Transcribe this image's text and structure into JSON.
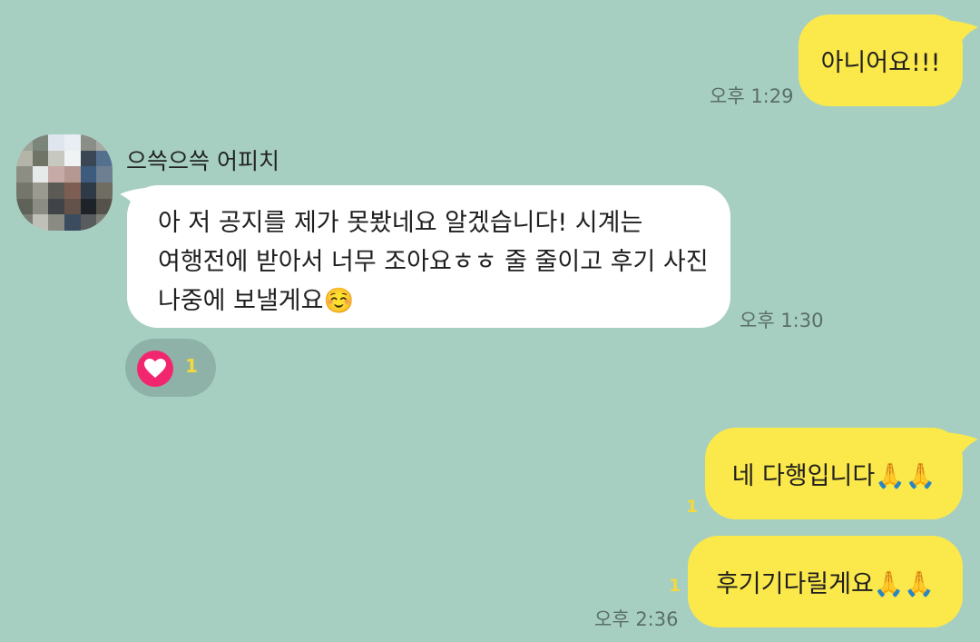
{
  "messages": {
    "m1": {
      "text": "아니어요!!!",
      "time": "오후 1:29"
    },
    "m2": {
      "sender": "으쓱으쓱 어피치",
      "lines": [
        "아 저 공지를 제가 못봤네요 알겠습니다! 시계는",
        "여행전에 받아서 너무 조아요ㅎㅎ 줄 줄이고 후기 사진",
        "나중에 보낼게요☺️"
      ],
      "time": "오후 1:30",
      "reaction_count": "1"
    },
    "m3": {
      "text": "네 다행입니다🙏🙏",
      "unread": "1"
    },
    "m4": {
      "text": "후기기다릴게요🙏🙏",
      "unread": "1",
      "time": "오후 2:36"
    }
  },
  "colors": {
    "background": "#a6cfc2",
    "my_bubble": "#fbe84a",
    "their_bubble": "#ffffff",
    "heart": "#f2266e",
    "unread": "#f4d93d"
  },
  "icons": {
    "reaction": "heart-icon",
    "avatar": "pixelated-profile-photo"
  }
}
